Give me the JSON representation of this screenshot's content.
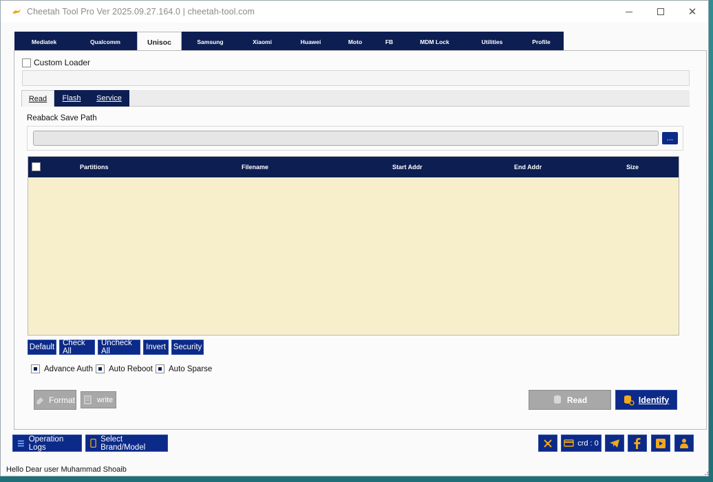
{
  "window": {
    "title": "Cheetah Tool Pro Ver 2025.09.27.164.0 | cheetah-tool.com",
    "minimize_icon": "minimize-icon",
    "maximize_icon": "maximize-icon",
    "close_glyph": "✕"
  },
  "tabs": [
    {
      "label": "Mediatek"
    },
    {
      "label": "Qualcomm"
    },
    {
      "label": "Unisoc",
      "active": true
    },
    {
      "label": "Samsung"
    },
    {
      "label": "Xiaomi"
    },
    {
      "label": "Huawei"
    },
    {
      "label": "Moto"
    },
    {
      "label": "FB"
    },
    {
      "label": "MDM Lock"
    },
    {
      "label": "Utilities"
    },
    {
      "label": "Profile"
    }
  ],
  "custom_loader": {
    "label": "Custom Loader",
    "checked": false,
    "value": ""
  },
  "subtabs": [
    {
      "label": "Read",
      "active": true
    },
    {
      "label": "Flash"
    },
    {
      "label": "Service"
    }
  ],
  "readback": {
    "label": "Reaback Save Path",
    "value": "",
    "browse_label": "..."
  },
  "table": {
    "columns": [
      "Partitions",
      "Filename",
      "Start Addr",
      "End Addr",
      "Size"
    ],
    "rows": []
  },
  "actions": {
    "default": "Default",
    "check_all": "Check All",
    "uncheck_all": "Uncheck All",
    "invert": "Invert",
    "security": "Security"
  },
  "options": {
    "advance_auth": "Advance Auth",
    "auto_reboot": "Auto Reboot",
    "auto_sparse": "Auto Sparse"
  },
  "buttons": {
    "format": "Format",
    "write": "write",
    "read": "Read",
    "identify": "Identify"
  },
  "bottom": {
    "operation_logs": "Operation Logs",
    "select_brand": "Select Brand/Model",
    "credits": "crd : 0"
  },
  "status": "Hello Dear user Muhammad Shoaib",
  "colors": {
    "navy": "#0c1e52",
    "button_blue": "#0c2a87",
    "table_bg": "#f7efcc",
    "disabled": "#a8a8a8",
    "accent_orange": "#f0a81c"
  }
}
